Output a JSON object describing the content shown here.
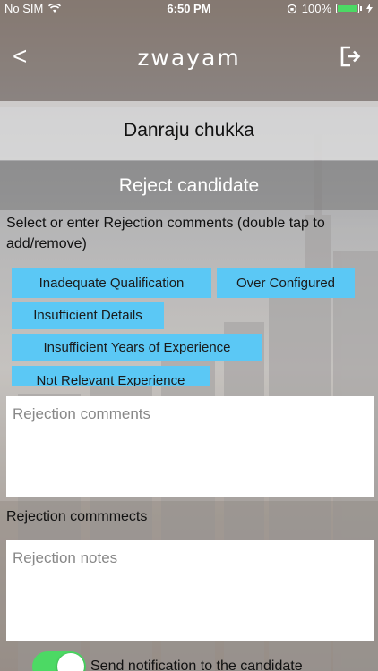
{
  "status_bar": {
    "carrier": "No SIM",
    "time": "6:50 PM",
    "battery_percent": "100%",
    "icons": [
      "wifi-icon",
      "rotation-lock-icon",
      "battery-icon",
      "charging-icon"
    ]
  },
  "nav": {
    "back_glyph": "<",
    "app_title": "zwayam",
    "logout_icon": "logout-icon"
  },
  "candidate": {
    "name": "Danraju chukka"
  },
  "header": {
    "title": "Reject candidate"
  },
  "instructions": "Select or enter Rejection comments (double tap to add/remove)",
  "reasons": [
    "Inadequate Qualification",
    "Over Configured",
    "Insufficient Details",
    "Insufficient Years of Experience",
    "Not Relevant Experience"
  ],
  "comments": {
    "placeholder": "Rejection comments",
    "value": ""
  },
  "notes": {
    "label": "Rejection commmects",
    "placeholder": "Rejection notes",
    "value": ""
  },
  "notification": {
    "label": "Send notification to the candidate",
    "enabled": true
  },
  "colors": {
    "chip": "#5bc8f5",
    "toggle_on": "#4cd964"
  }
}
